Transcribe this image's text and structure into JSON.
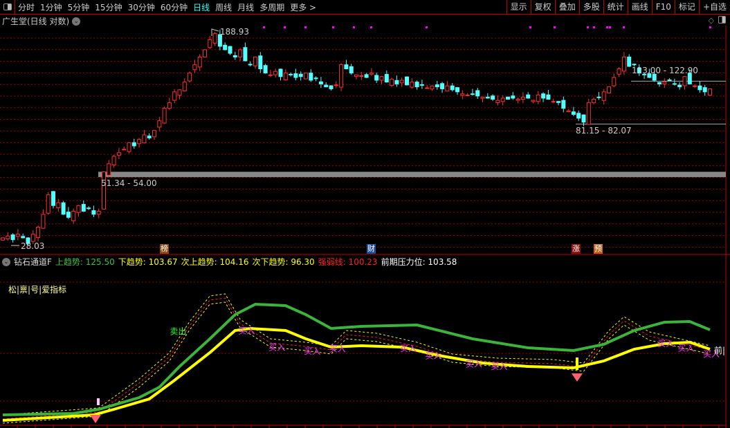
{
  "toolbar": {
    "periods": [
      "分时",
      "1分钟",
      "5分钟",
      "15分钟",
      "30分钟",
      "60分钟",
      "日线",
      "周线",
      "月线",
      "多周期",
      "更多 >"
    ],
    "active_period": "日线",
    "right_buttons": [
      "显示",
      "复权",
      "叠加",
      "多股",
      "统计",
      "画线",
      "F10",
      "标记",
      "+自选"
    ]
  },
  "chart": {
    "title": "广生堂(日线 对数)",
    "high_label": "188.93",
    "low_label": "28.03",
    "zones": [
      {
        "label": "51.34 - 54.00"
      },
      {
        "label": "123.00 - 122.90"
      },
      {
        "label": "81.15 - 82.07"
      }
    ],
    "events": [
      {
        "label": "榜",
        "color": "#8b4a13"
      },
      {
        "label": "财",
        "color": "#1e4f9a"
      },
      {
        "label": "涨",
        "color": "#8a1010"
      },
      {
        "label": "预",
        "color": "#c0601a"
      }
    ],
    "closes": [
      30,
      30.5,
      29.5,
      31,
      30,
      28.5,
      31,
      33,
      37,
      44,
      40,
      41,
      37,
      36,
      38,
      40,
      38,
      39,
      37,
      38,
      54,
      58,
      62,
      64,
      66,
      70,
      68,
      72,
      75,
      73,
      78,
      85,
      95,
      100,
      110,
      112,
      120,
      130,
      140,
      150,
      160,
      175,
      185,
      165,
      160,
      155,
      150,
      160,
      145,
      140,
      150,
      135,
      130,
      128,
      132,
      126,
      130,
      128,
      125,
      126,
      130,
      122,
      124,
      118,
      115,
      113,
      117,
      140,
      135,
      130,
      128,
      127,
      125,
      130,
      122,
      126,
      120,
      123,
      118,
      122,
      117,
      120,
      115,
      117,
      114,
      116,
      115,
      113,
      116,
      112,
      110,
      108,
      107,
      108,
      106,
      105,
      104,
      103,
      102,
      104,
      103,
      104,
      103,
      105,
      104,
      102,
      107,
      104,
      103,
      101,
      100,
      95,
      93,
      90,
      87,
      84,
      100,
      103,
      105,
      110,
      115,
      125,
      135,
      150,
      138,
      140,
      130,
      128,
      125,
      122,
      118,
      120,
      122,
      118,
      115,
      126,
      118,
      116,
      112,
      110,
      113
    ],
    "up_color": "#ff3030",
    "down_color": "#54ffff"
  },
  "indicator": {
    "name": "钻石通道F",
    "legend": [
      {
        "label": "上趋势: 125.50",
        "color": "#40c040"
      },
      {
        "label": "下趋势: 103.67",
        "color": "#ffff00"
      },
      {
        "label": "次上趋势: 104.16",
        "color": "#ffff00"
      },
      {
        "label": "次下趋势: 96.30",
        "color": "#ffff00"
      },
      {
        "label": "强弱线: 100.23",
        "color": "#ff2020"
      },
      {
        "label": "前期压力位: 103.58",
        "color": "#ffffff"
      }
    ],
    "note": "松|禀|号|爱指标",
    "right_label": "前|",
    "green": {
      "idx": [
        0,
        14,
        19,
        27,
        31,
        35,
        41,
        46,
        50,
        56,
        60,
        65,
        71,
        82,
        93,
        104,
        113,
        119,
        125,
        131,
        136,
        140
      ],
      "val": [
        10,
        11,
        14,
        22.5,
        30,
        45,
        65,
        82.5,
        90,
        89,
        82.5,
        72.5,
        74,
        75,
        65,
        58.5,
        56.5,
        61,
        71,
        77,
        77.5,
        71.5
      ]
    },
    "yellow": {
      "idx": [
        0,
        18,
        22,
        29,
        34,
        41,
        46,
        49,
        56,
        60,
        65,
        71,
        79,
        87,
        95,
        104,
        113,
        119,
        125,
        131,
        136,
        140
      ],
      "val": [
        6,
        10,
        14,
        21.5,
        35,
        55,
        71,
        72.5,
        71,
        65,
        59,
        60,
        59,
        52.5,
        47.5,
        45,
        44,
        49,
        57.5,
        61.5,
        62.5,
        57.5
      ]
    },
    "band": {
      "idx": [
        0,
        19,
        27,
        33,
        37,
        41,
        44,
        47,
        53,
        60,
        65,
        68,
        74,
        82,
        89,
        98,
        109,
        115,
        120,
        123,
        128,
        134,
        140
      ],
      "val": [
        10,
        15,
        36,
        55,
        77.5,
        96,
        97.5,
        79,
        65,
        62.5,
        60,
        71,
        69,
        62.5,
        54,
        51,
        50,
        47.5,
        71,
        81,
        70,
        65,
        60
      ]
    },
    "buy_label": "买入",
    "sell_label": "卖出",
    "buy_idx": [
      48,
      54,
      61,
      66,
      80,
      85,
      93,
      98,
      131,
      135,
      140
    ],
    "sell_idx": [
      35
    ]
  }
}
